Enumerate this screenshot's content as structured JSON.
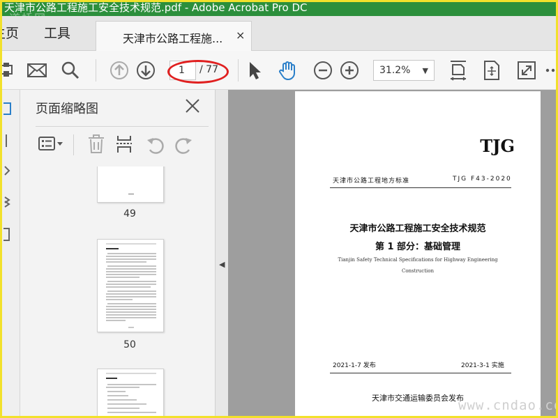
{
  "window": {
    "title": "天津市公路工程施工安全技术规范.pdf - Adobe Acrobat Pro DC",
    "watermark_top": "道桥网"
  },
  "tabs": {
    "home": "主页",
    "tools": "工具",
    "document": "天津市公路工程施...",
    "close": "×"
  },
  "toolbar": {
    "current_page": "1",
    "total_pages": "/ 77",
    "zoom": "31.2%"
  },
  "thumbnails_panel": {
    "title": "页面缩略图",
    "pages": [
      {
        "number": "49"
      },
      {
        "number": "50"
      }
    ]
  },
  "document": {
    "header": "TJG",
    "standard_type": "天津市公路工程地方标准",
    "standard_code": "TJG F43-2020",
    "title_line1": "天津市公路工程施工安全技术规范",
    "title_line2": "第 1 部分：基础管理",
    "english_line1": "Tianjin Safety Technical Specifications for Highway Engineering",
    "english_line2": "Construction",
    "issue_date": "2021-1-7 发布",
    "implement_date": "2021-3-1 实施",
    "publisher": "天津市交通运输委员会发布"
  },
  "watermark_bottom": "www.cndao.co",
  "colors": {
    "title_bar": "#2c8f3c",
    "accent_blue": "#2a7fc9",
    "annotation_red": "#e02020",
    "frame_yellow": "#f2e12b"
  }
}
